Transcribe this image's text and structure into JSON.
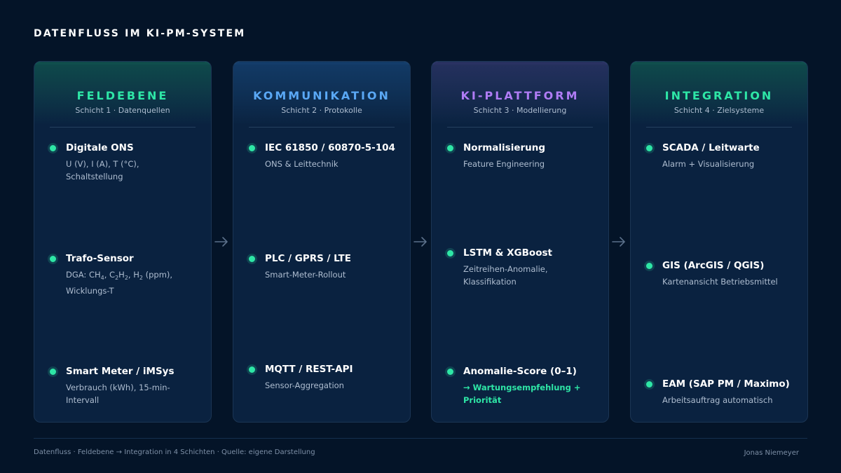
{
  "title": "DATENFLUSS IM KI-PM-SYSTEM",
  "columns": [
    {
      "title": "FELDEBENE",
      "subtitle": "Schicht 1 · Datenquellen",
      "accent": "#2ee6a6",
      "glow": "#0f4a4a",
      "items": [
        {
          "title": "Digitale ONS",
          "desc": "U (V), I (A), T (°C), Schaltstellung"
        },
        {
          "title": "Trafo-Sensor",
          "desc_html": "DGA: CH<sub>4</sub>, C<sub>2</sub>H<sub>2</sub>, H<sub>2</sub> (ppm), Wicklungs-T"
        },
        {
          "title": "Smart Meter / iMSys",
          "desc": "Verbrauch (kWh), 15-min-Intervall"
        }
      ]
    },
    {
      "title": "KOMMUNIKATION",
      "subtitle": "Schicht 2 · Protokolle",
      "accent": "#5aa8f5",
      "glow": "#123a66",
      "items": [
        {
          "title": "IEC 61850 / 60870-5-104",
          "desc": "ONS & Leittechnik"
        },
        {
          "title": "PLC / GPRS / LTE",
          "desc": "Smart-Meter-Rollout"
        },
        {
          "title": "MQTT / REST-API",
          "desc": "Sensor-Aggregation"
        }
      ]
    },
    {
      "title": "KI-PLATTFORM",
      "subtitle": "Schicht 3 · Modellierung",
      "accent": "#b07cf5",
      "glow": "#25305e",
      "items": [
        {
          "title": "Normalisierung",
          "desc": "Feature Engineering"
        },
        {
          "title": "LSTM & XGBoost",
          "desc": "Zeitreihen-Anomalie, Klassifikation"
        },
        {
          "title": "Anomalie-Score (0–1)",
          "desc": "→ Wartungsempfehlung + Priorität",
          "desc_accent": true
        }
      ]
    },
    {
      "title": "INTEGRATION",
      "subtitle": "Schicht 4 · Zielsysteme",
      "accent": "#2ee6a6",
      "glow": "#0f4a4a",
      "items": [
        {
          "title": "SCADA / Leitwarte",
          "desc": "Alarm + Visualisierung"
        },
        {
          "title": "GIS (ArcGIS / QGIS)",
          "desc": "Kartenansicht Betriebsmittel"
        },
        {
          "title": "EAM (SAP PM / Maximo)",
          "desc": "Arbeitsauftrag automatisch"
        }
      ]
    }
  ],
  "footer": {
    "caption": "Datenfluss · Feldebene → Integration in 4 Schichten · Quelle: eigene Darstellung",
    "author": "Jonas Niemeyer"
  },
  "colors": {
    "background": "#041428",
    "card": "#0a2240",
    "dot": "#2ee6a6",
    "arrow": "#5b708a"
  },
  "icons": [
    "arrow-right-icon",
    "bullet-dot-icon"
  ]
}
